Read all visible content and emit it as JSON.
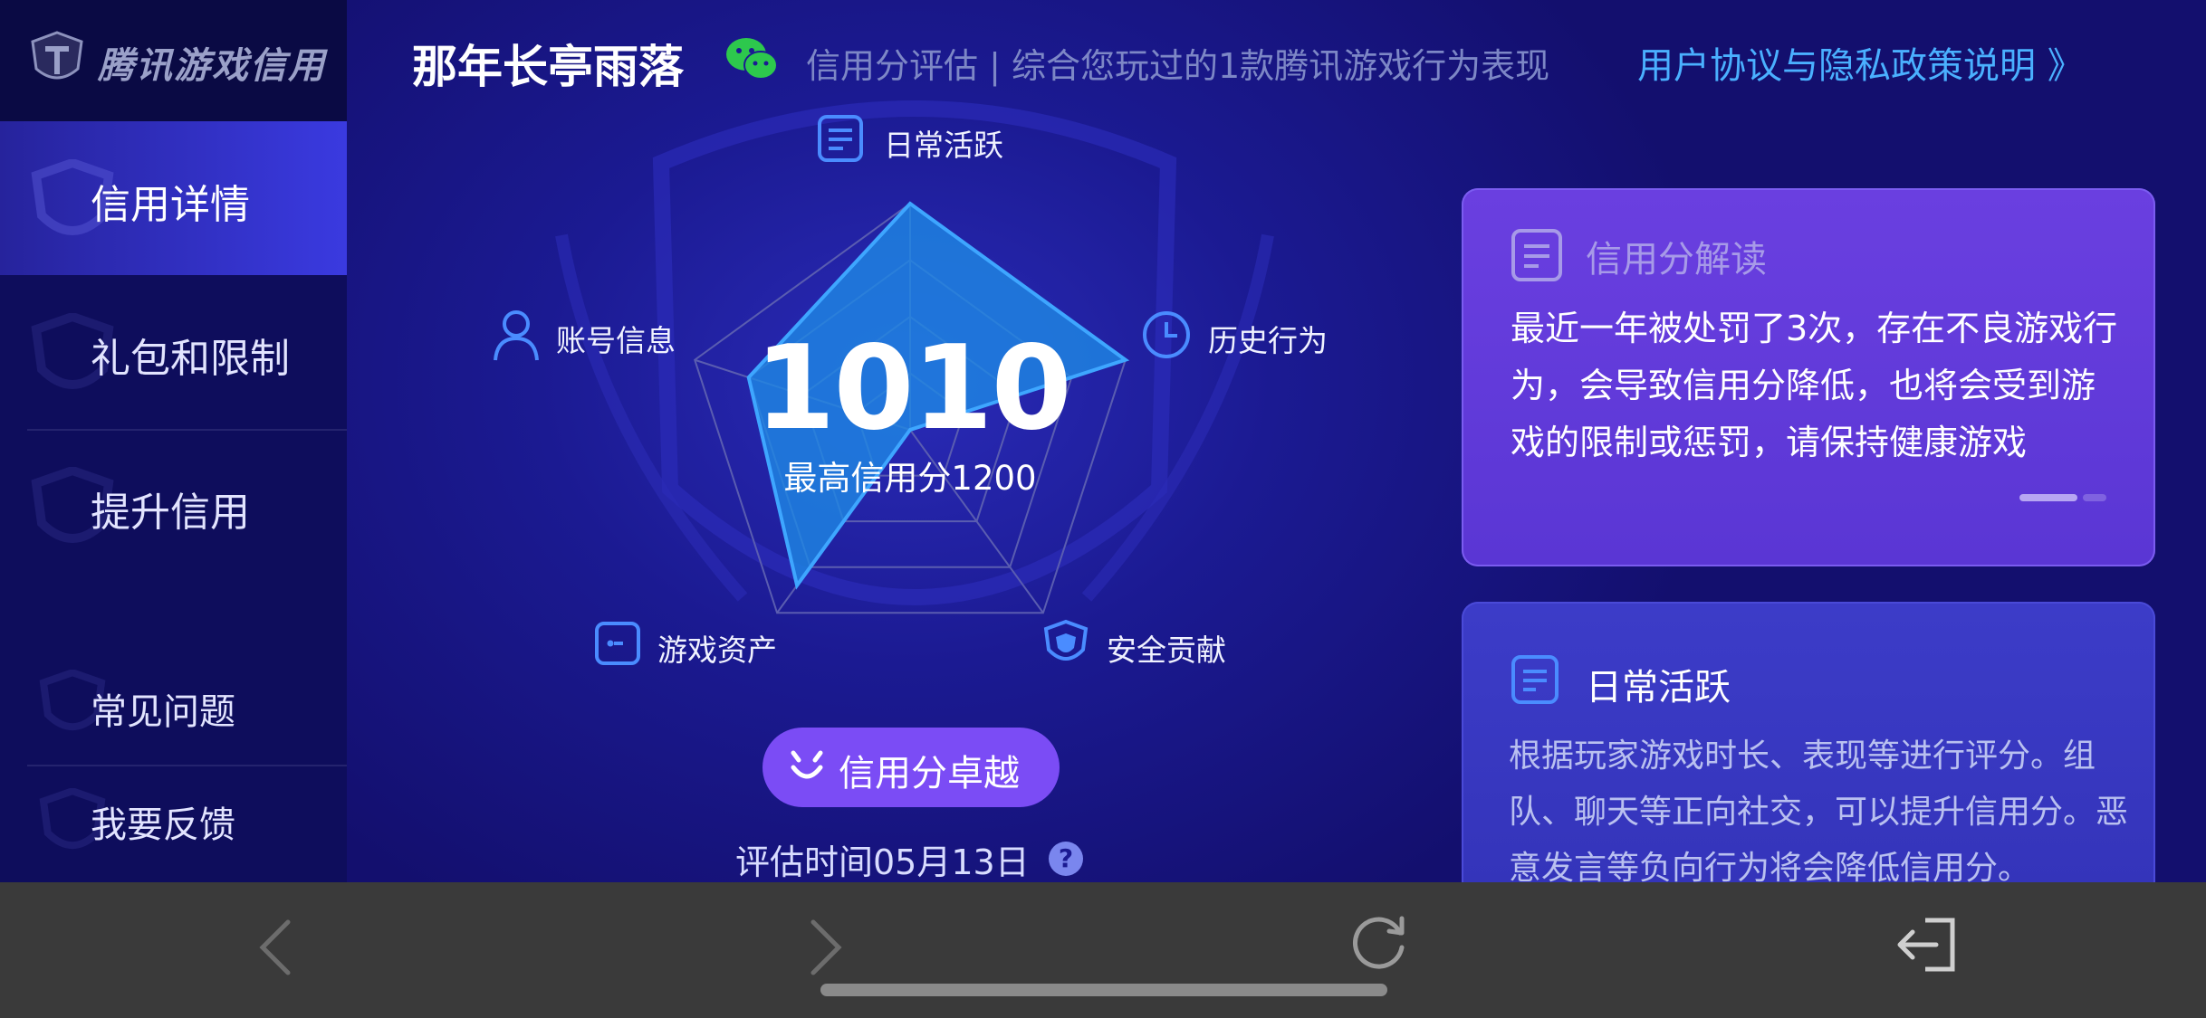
{
  "app": {
    "logo_text": "腾讯游戏信用",
    "title": "那年长亭雨落",
    "subtitle": "信用分评估 | 综合您玩过的1款腾讯游戏行为表现",
    "policy_link": "用户协议与隐私政策说明 》"
  },
  "sidebar": {
    "items": [
      {
        "label": "信用详情",
        "active": true
      },
      {
        "label": "礼包和限制",
        "active": false
      },
      {
        "label": "提升信用",
        "active": false
      },
      {
        "label": "常见问题",
        "active": false
      },
      {
        "label": "我要反馈",
        "active": false
      }
    ]
  },
  "radar": {
    "dimensions": [
      {
        "label": "日常活跃",
        "icon": "document-icon",
        "value": 1.0
      },
      {
        "label": "历史行为",
        "icon": "clock-icon",
        "value": 1.0
      },
      {
        "label": "安全贡献",
        "icon": "shield-icon",
        "value": 0.0
      },
      {
        "label": "游戏资产",
        "icon": "wallet-icon",
        "value": 0.85
      },
      {
        "label": "账号信息",
        "icon": "user-icon",
        "value": 0.75
      }
    ],
    "score": "1010",
    "max_score_text": "最高信用分1200",
    "badge_label": "信用分卓越",
    "eval_time": "评估时间05月13日",
    "help_glyph": "?"
  },
  "cards": {
    "interpret": {
      "title": "信用分解读",
      "body": "最近一年被处罚了3次，存在不良游戏行为，会导致信用分降低，也将会受到游戏的限制或惩罚，请保持健康游戏"
    },
    "daily": {
      "title": "日常活跃",
      "body": "根据玩家游戏时长、表现等进行评分。组队、聊天等正向社交，可以提升信用分。恶意发言等负向行为将会降低信用分。"
    }
  },
  "colors": {
    "background": "#1b1a92",
    "sidebar": "#0e0d5c",
    "accent": "#4ab0ff",
    "card_purple": "#6a3fe0",
    "card_blue": "#3c3cc8",
    "radar_fill": "#1e88e5",
    "badge": "#7b4cf5"
  }
}
